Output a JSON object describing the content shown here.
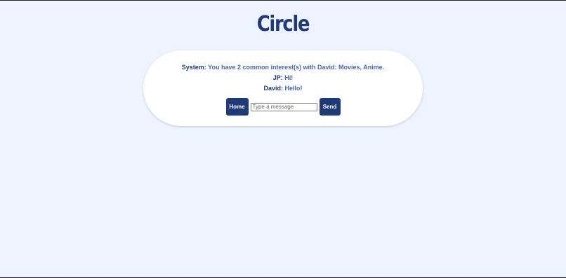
{
  "app": {
    "title": "Circle"
  },
  "chat": {
    "messages": [
      {
        "sender": "System:",
        "text": "You have 2 common interest(s) with David: Movies, Anime."
      },
      {
        "sender": "JP:",
        "text": "Hi!"
      },
      {
        "sender": "David:",
        "text": "Hello!"
      }
    ]
  },
  "controls": {
    "home_label": "Home",
    "input_value": "",
    "input_placeholder": "Type a message",
    "send_label": "Send"
  },
  "colors": {
    "background": "#eef4ff",
    "accent": "#1f3a78",
    "message_text": "#4a67a8",
    "card": "#ffffff"
  }
}
